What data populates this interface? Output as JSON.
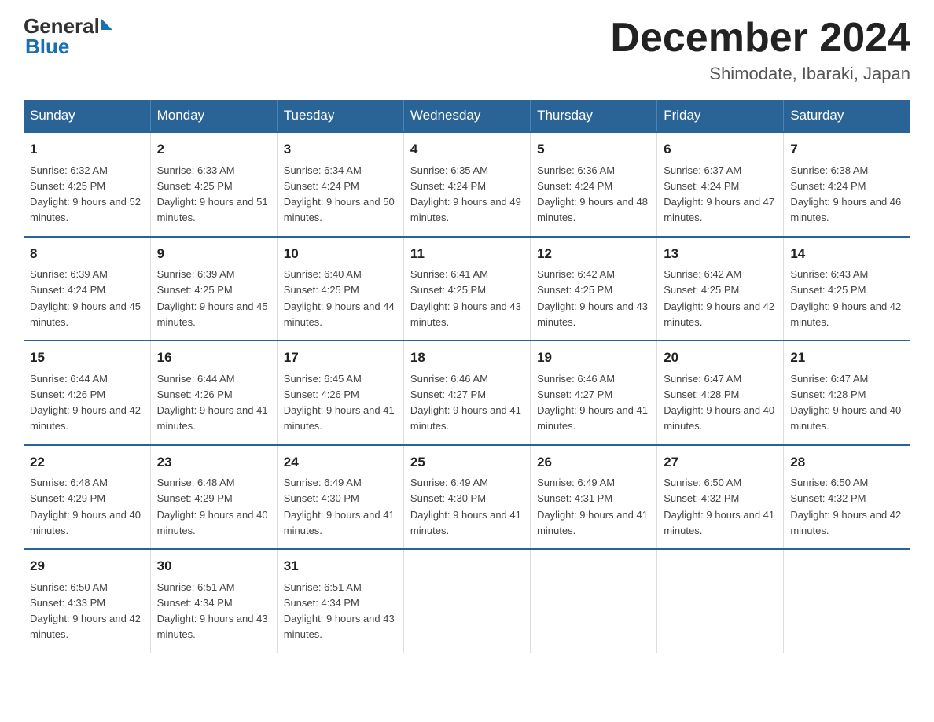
{
  "logo": {
    "general": "General",
    "triangle": "▶",
    "blue": "Blue"
  },
  "header": {
    "title": "December 2024",
    "subtitle": "Shimodate, Ibaraki, Japan"
  },
  "days_of_week": [
    "Sunday",
    "Monday",
    "Tuesday",
    "Wednesday",
    "Thursday",
    "Friday",
    "Saturday"
  ],
  "weeks": [
    [
      {
        "num": "1",
        "sunrise": "6:32 AM",
        "sunset": "4:25 PM",
        "daylight": "9 hours and 52 minutes."
      },
      {
        "num": "2",
        "sunrise": "6:33 AM",
        "sunset": "4:25 PM",
        "daylight": "9 hours and 51 minutes."
      },
      {
        "num": "3",
        "sunrise": "6:34 AM",
        "sunset": "4:24 PM",
        "daylight": "9 hours and 50 minutes."
      },
      {
        "num": "4",
        "sunrise": "6:35 AM",
        "sunset": "4:24 PM",
        "daylight": "9 hours and 49 minutes."
      },
      {
        "num": "5",
        "sunrise": "6:36 AM",
        "sunset": "4:24 PM",
        "daylight": "9 hours and 48 minutes."
      },
      {
        "num": "6",
        "sunrise": "6:37 AM",
        "sunset": "4:24 PM",
        "daylight": "9 hours and 47 minutes."
      },
      {
        "num": "7",
        "sunrise": "6:38 AM",
        "sunset": "4:24 PM",
        "daylight": "9 hours and 46 minutes."
      }
    ],
    [
      {
        "num": "8",
        "sunrise": "6:39 AM",
        "sunset": "4:24 PM",
        "daylight": "9 hours and 45 minutes."
      },
      {
        "num": "9",
        "sunrise": "6:39 AM",
        "sunset": "4:25 PM",
        "daylight": "9 hours and 45 minutes."
      },
      {
        "num": "10",
        "sunrise": "6:40 AM",
        "sunset": "4:25 PM",
        "daylight": "9 hours and 44 minutes."
      },
      {
        "num": "11",
        "sunrise": "6:41 AM",
        "sunset": "4:25 PM",
        "daylight": "9 hours and 43 minutes."
      },
      {
        "num": "12",
        "sunrise": "6:42 AM",
        "sunset": "4:25 PM",
        "daylight": "9 hours and 43 minutes."
      },
      {
        "num": "13",
        "sunrise": "6:42 AM",
        "sunset": "4:25 PM",
        "daylight": "9 hours and 42 minutes."
      },
      {
        "num": "14",
        "sunrise": "6:43 AM",
        "sunset": "4:25 PM",
        "daylight": "9 hours and 42 minutes."
      }
    ],
    [
      {
        "num": "15",
        "sunrise": "6:44 AM",
        "sunset": "4:26 PM",
        "daylight": "9 hours and 42 minutes."
      },
      {
        "num": "16",
        "sunrise": "6:44 AM",
        "sunset": "4:26 PM",
        "daylight": "9 hours and 41 minutes."
      },
      {
        "num": "17",
        "sunrise": "6:45 AM",
        "sunset": "4:26 PM",
        "daylight": "9 hours and 41 minutes."
      },
      {
        "num": "18",
        "sunrise": "6:46 AM",
        "sunset": "4:27 PM",
        "daylight": "9 hours and 41 minutes."
      },
      {
        "num": "19",
        "sunrise": "6:46 AM",
        "sunset": "4:27 PM",
        "daylight": "9 hours and 41 minutes."
      },
      {
        "num": "20",
        "sunrise": "6:47 AM",
        "sunset": "4:28 PM",
        "daylight": "9 hours and 40 minutes."
      },
      {
        "num": "21",
        "sunrise": "6:47 AM",
        "sunset": "4:28 PM",
        "daylight": "9 hours and 40 minutes."
      }
    ],
    [
      {
        "num": "22",
        "sunrise": "6:48 AM",
        "sunset": "4:29 PM",
        "daylight": "9 hours and 40 minutes."
      },
      {
        "num": "23",
        "sunrise": "6:48 AM",
        "sunset": "4:29 PM",
        "daylight": "9 hours and 40 minutes."
      },
      {
        "num": "24",
        "sunrise": "6:49 AM",
        "sunset": "4:30 PM",
        "daylight": "9 hours and 41 minutes."
      },
      {
        "num": "25",
        "sunrise": "6:49 AM",
        "sunset": "4:30 PM",
        "daylight": "9 hours and 41 minutes."
      },
      {
        "num": "26",
        "sunrise": "6:49 AM",
        "sunset": "4:31 PM",
        "daylight": "9 hours and 41 minutes."
      },
      {
        "num": "27",
        "sunrise": "6:50 AM",
        "sunset": "4:32 PM",
        "daylight": "9 hours and 41 minutes."
      },
      {
        "num": "28",
        "sunrise": "6:50 AM",
        "sunset": "4:32 PM",
        "daylight": "9 hours and 42 minutes."
      }
    ],
    [
      {
        "num": "29",
        "sunrise": "6:50 AM",
        "sunset": "4:33 PM",
        "daylight": "9 hours and 42 minutes."
      },
      {
        "num": "30",
        "sunrise": "6:51 AM",
        "sunset": "4:34 PM",
        "daylight": "9 hours and 43 minutes."
      },
      {
        "num": "31",
        "sunrise": "6:51 AM",
        "sunset": "4:34 PM",
        "daylight": "9 hours and 43 minutes."
      },
      null,
      null,
      null,
      null
    ]
  ]
}
